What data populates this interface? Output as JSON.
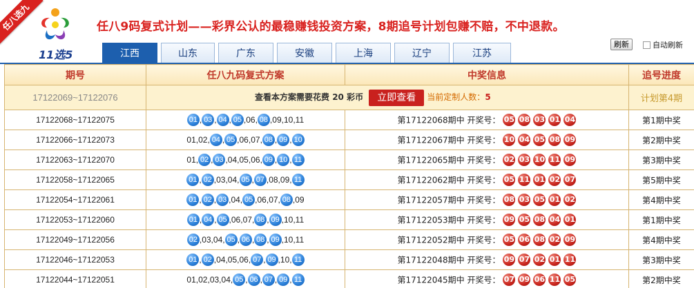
{
  "header": {
    "ribbon_text": "任八选九",
    "logo_text": "11选5",
    "headline": "任八9码复式计划——彩界公认的最稳赚钱投资方案，8期追号计划包赚不赔，不中退款。",
    "refresh_label": "刷新",
    "auto_refresh_label": "自动刷新"
  },
  "tabs": [
    {
      "label": "江西",
      "active": true
    },
    {
      "label": "山东",
      "active": false
    },
    {
      "label": "广东",
      "active": false
    },
    {
      "label": "安徽",
      "active": false
    },
    {
      "label": "上海",
      "active": false
    },
    {
      "label": "辽宁",
      "active": false
    },
    {
      "label": "江苏",
      "active": false
    }
  ],
  "table": {
    "headers": [
      "期号",
      "任八九码复式方案",
      "中奖信息",
      "追号进度"
    ],
    "promo": {
      "period": "17122069~17122076",
      "cost_prefix": "查看本方案需要花费",
      "cost_amount": "20",
      "cost_suffix": "彩币",
      "button_label": "立即查看",
      "subscribers_label": "当前定制人数：",
      "subscribers_count": "5",
      "progress": "计划第4期"
    },
    "rows": [
      {
        "period": "17122068~17122075",
        "plan": [
          {
            "n": "01",
            "h": true
          },
          {
            "n": "03",
            "h": true
          },
          {
            "n": "04",
            "h": true
          },
          {
            "n": "05",
            "h": true
          },
          {
            "n": "06",
            "h": false
          },
          {
            "n": "08",
            "h": true
          },
          {
            "n": "09",
            "h": false
          },
          {
            "n": "10",
            "h": false
          },
          {
            "n": "11",
            "h": false
          }
        ],
        "info_prefix": "第17122068期中 开奖号：",
        "draw": [
          "05",
          "08",
          "03",
          "01",
          "04"
        ],
        "progress": "第1期中奖"
      },
      {
        "period": "17122066~17122073",
        "plan": [
          {
            "n": "01",
            "h": false
          },
          {
            "n": "02",
            "h": false
          },
          {
            "n": "04",
            "h": true
          },
          {
            "n": "05",
            "h": true
          },
          {
            "n": "06",
            "h": false
          },
          {
            "n": "07",
            "h": false
          },
          {
            "n": "08",
            "h": true
          },
          {
            "n": "09",
            "h": true
          },
          {
            "n": "10",
            "h": true
          }
        ],
        "info_prefix": "第17122067期中 开奖号：",
        "draw": [
          "10",
          "04",
          "05",
          "08",
          "09"
        ],
        "progress": "第2期中奖"
      },
      {
        "period": "17122063~17122070",
        "plan": [
          {
            "n": "01",
            "h": false
          },
          {
            "n": "02",
            "h": true
          },
          {
            "n": "03",
            "h": true
          },
          {
            "n": "04",
            "h": false
          },
          {
            "n": "05",
            "h": false
          },
          {
            "n": "06",
            "h": false
          },
          {
            "n": "09",
            "h": true
          },
          {
            "n": "10",
            "h": true
          },
          {
            "n": "11",
            "h": true
          }
        ],
        "info_prefix": "第17122065期中 开奖号：",
        "draw": [
          "02",
          "03",
          "10",
          "11",
          "09"
        ],
        "progress": "第3期中奖"
      },
      {
        "period": "17122058~17122065",
        "plan": [
          {
            "n": "01",
            "h": true
          },
          {
            "n": "02",
            "h": true
          },
          {
            "n": "03",
            "h": false
          },
          {
            "n": "04",
            "h": false
          },
          {
            "n": "05",
            "h": true
          },
          {
            "n": "07",
            "h": true
          },
          {
            "n": "08",
            "h": false
          },
          {
            "n": "09",
            "h": false
          },
          {
            "n": "11",
            "h": true
          }
        ],
        "info_prefix": "第17122062期中 开奖号：",
        "draw": [
          "05",
          "11",
          "01",
          "02",
          "07"
        ],
        "progress": "第5期中奖"
      },
      {
        "period": "17122054~17122061",
        "plan": [
          {
            "n": "01",
            "h": true
          },
          {
            "n": "02",
            "h": true
          },
          {
            "n": "03",
            "h": true
          },
          {
            "n": "04",
            "h": false
          },
          {
            "n": "05",
            "h": true
          },
          {
            "n": "06",
            "h": false
          },
          {
            "n": "07",
            "h": false
          },
          {
            "n": "08",
            "h": true
          },
          {
            "n": "09",
            "h": false
          }
        ],
        "info_prefix": "第17122057期中 开奖号：",
        "draw": [
          "08",
          "03",
          "05",
          "01",
          "02"
        ],
        "progress": "第4期中奖"
      },
      {
        "period": "17122053~17122060",
        "plan": [
          {
            "n": "01",
            "h": true
          },
          {
            "n": "04",
            "h": true
          },
          {
            "n": "05",
            "h": true
          },
          {
            "n": "06",
            "h": false
          },
          {
            "n": "07",
            "h": false
          },
          {
            "n": "08",
            "h": true
          },
          {
            "n": "09",
            "h": true
          },
          {
            "n": "10",
            "h": false
          },
          {
            "n": "11",
            "h": false
          }
        ],
        "info_prefix": "第17122053期中 开奖号：",
        "draw": [
          "09",
          "05",
          "08",
          "04",
          "01"
        ],
        "progress": "第1期中奖"
      },
      {
        "period": "17122049~17122056",
        "plan": [
          {
            "n": "02",
            "h": true
          },
          {
            "n": "03",
            "h": false
          },
          {
            "n": "04",
            "h": false
          },
          {
            "n": "05",
            "h": true
          },
          {
            "n": "06",
            "h": true
          },
          {
            "n": "08",
            "h": true
          },
          {
            "n": "09",
            "h": true
          },
          {
            "n": "10",
            "h": false
          },
          {
            "n": "11",
            "h": false
          }
        ],
        "info_prefix": "第17122052期中 开奖号：",
        "draw": [
          "05",
          "06",
          "08",
          "02",
          "09"
        ],
        "progress": "第4期中奖"
      },
      {
        "period": "17122046~17122053",
        "plan": [
          {
            "n": "01",
            "h": true
          },
          {
            "n": "02",
            "h": true
          },
          {
            "n": "04",
            "h": false
          },
          {
            "n": "05",
            "h": false
          },
          {
            "n": "06",
            "h": false
          },
          {
            "n": "07",
            "h": true
          },
          {
            "n": "09",
            "h": true
          },
          {
            "n": "10",
            "h": false
          },
          {
            "n": "11",
            "h": true
          }
        ],
        "info_prefix": "第17122048期中 开奖号：",
        "draw": [
          "09",
          "07",
          "02",
          "01",
          "11"
        ],
        "progress": "第3期中奖"
      },
      {
        "period": "17122044~17122051",
        "plan": [
          {
            "n": "01",
            "h": false
          },
          {
            "n": "02",
            "h": false
          },
          {
            "n": "03",
            "h": false
          },
          {
            "n": "04",
            "h": false
          },
          {
            "n": "05",
            "h": true
          },
          {
            "n": "06",
            "h": true
          },
          {
            "n": "07",
            "h": true
          },
          {
            "n": "09",
            "h": true
          },
          {
            "n": "11",
            "h": true
          }
        ],
        "info_prefix": "第17122045期中 开奖号：",
        "draw": [
          "07",
          "09",
          "06",
          "11",
          "05"
        ],
        "progress": "第2期中奖"
      }
    ]
  },
  "colors": {
    "brand_red": "#d9221f",
    "tab_blue": "#1d5fae",
    "ball_blue": "#2a7fd8",
    "ball_red": "#c9251d",
    "border_gold": "#d6b470"
  }
}
